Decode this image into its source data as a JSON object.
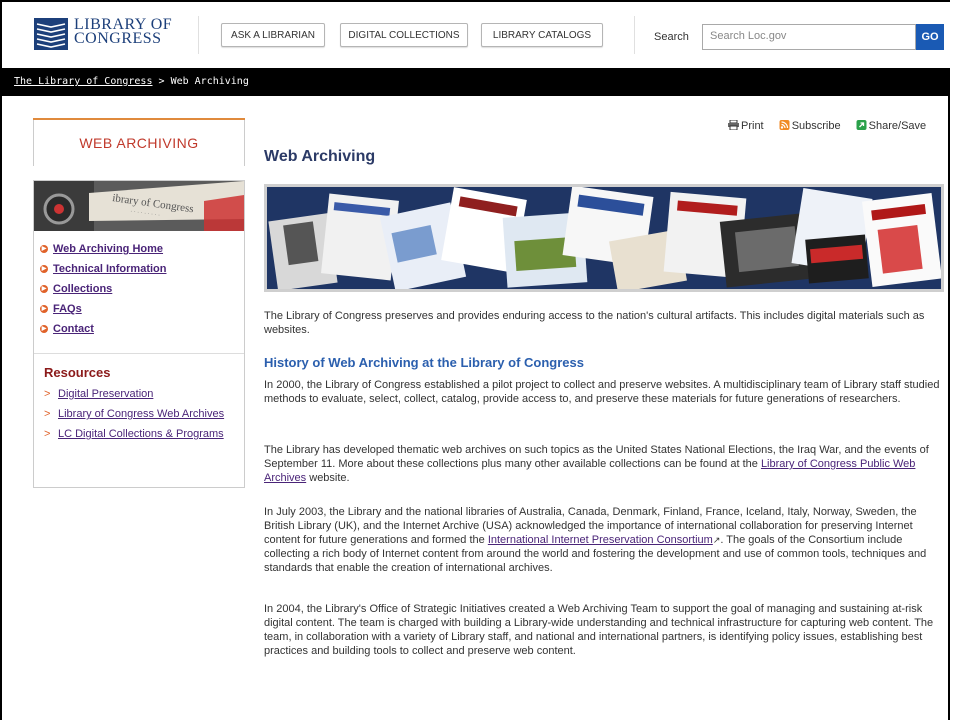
{
  "header": {
    "logo_line1": "LIBRARY OF",
    "logo_line2": "CONGRESS",
    "nav_buttons": [
      "ASK A LIBRARIAN",
      "DIGITAL COLLECTIONS",
      "LIBRARY CATALOGS"
    ],
    "search_label": "Search",
    "search_placeholder": "Search Loc.gov",
    "go_label": "GO"
  },
  "breadcrumb": {
    "home": "The Library of Congress",
    "separator": ">",
    "current": "Web Archiving"
  },
  "sidebar": {
    "title": "WEB ARCHIVING",
    "nav": [
      "Web Archiving Home",
      "Technical Information",
      "Collections",
      "FAQs",
      "Contact"
    ],
    "resources_title": "Resources",
    "resources": [
      "Digital Preservation",
      "Library of Congress Web Archives",
      "LC Digital Collections & Programs"
    ]
  },
  "tools": {
    "print": "Print",
    "subscribe": "Subscribe",
    "share": "Share/Save"
  },
  "main": {
    "title": "Web Archiving",
    "intro": "The Library of Congress preserves and provides enduring access to the nation's cultural artifacts. This includes digital materials such as websites.",
    "history_heading": "History of Web Archiving at the Library of Congress",
    "para1": "In 2000, the Library of Congress established a pilot project to collect and preserve websites. A multidisciplinary team of Library staff studied methods to evaluate, select, collect, catalog, provide access to, and preserve these materials for future generations of researchers.",
    "para2_before": "The Library has developed thematic web archives on such topics as the United States National Elections, the Iraq War, and the events of September 11. More about these collections plus many other available collections can be found at the ",
    "para2_link": "Library of Congress Public Web Archives",
    "para2_after": " website.",
    "para3_before": "In July 2003, the Library and the national libraries of Australia, Canada, Denmark, Finland, France, Iceland, Italy, Norway, Sweden, the British Library (UK), and the Internet Archive (USA) acknowledged the importance of international collaboration for preserving Internet content for future generations and formed the ",
    "para3_link": "International Internet Preservation Consortium",
    "para3_after": ". The goals of the Consortium include collecting a rich body of Internet content from around the world and fostering the development and use of common tools, techniques and standards that enable the creation of international archives.",
    "para4": "In 2004, the Library's Office of Strategic Initiatives created a Web Archiving Team to support the goal of managing and sustaining at-risk digital content. The team is charged with building a Library-wide understanding and technical infrastructure for capturing web content. The team, in collaboration with a variety of Library staff, and national and international partners, is identifying policy issues, establishing best practices and building tools to collect and preserve web content."
  },
  "colors": {
    "brand_blue": "#1c3f7a",
    "go_blue": "#1a5ab4",
    "accent_orange": "#e0622a",
    "link_purple": "#4a2478",
    "heading_blue": "#2b5fae"
  }
}
